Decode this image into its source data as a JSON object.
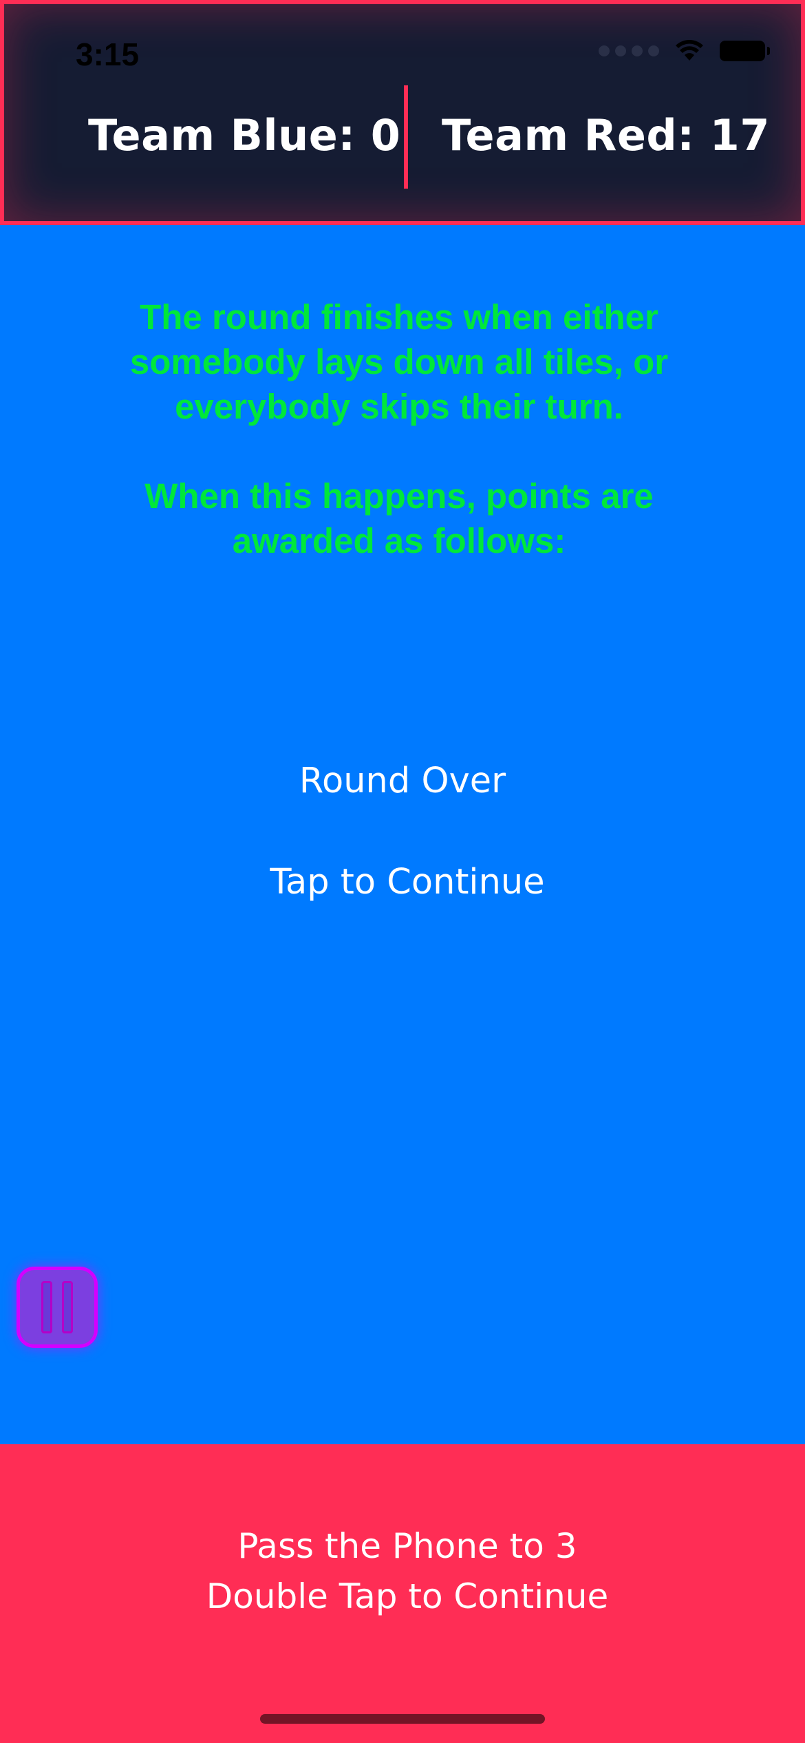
{
  "status_bar": {
    "time": "3:15",
    "icons": [
      "cellular-signal-icon",
      "wifi-icon",
      "battery-icon"
    ]
  },
  "scoreboard": {
    "team_blue": "Team Blue: 0",
    "team_red": "Team Red: 17"
  },
  "rules": {
    "paragraph_1": "The round finishes when either somebody lays down all tiles, or everybody skips their turn.",
    "paragraph_2": "When this happens, points are awarded as follows:"
  },
  "main": {
    "round_over": "Round Over",
    "tap_to_continue": "Tap to Continue"
  },
  "pause": {
    "icon": "pause-icon"
  },
  "footer": {
    "line_1": "Pass the Phone to 3",
    "line_2": "Double Tap to Continue"
  },
  "colors": {
    "background": "#007aff",
    "header_background": "#151c33",
    "accent_red": "#ff2d55",
    "rules_text": "#00e83a",
    "pause_border": "#d400ff"
  }
}
